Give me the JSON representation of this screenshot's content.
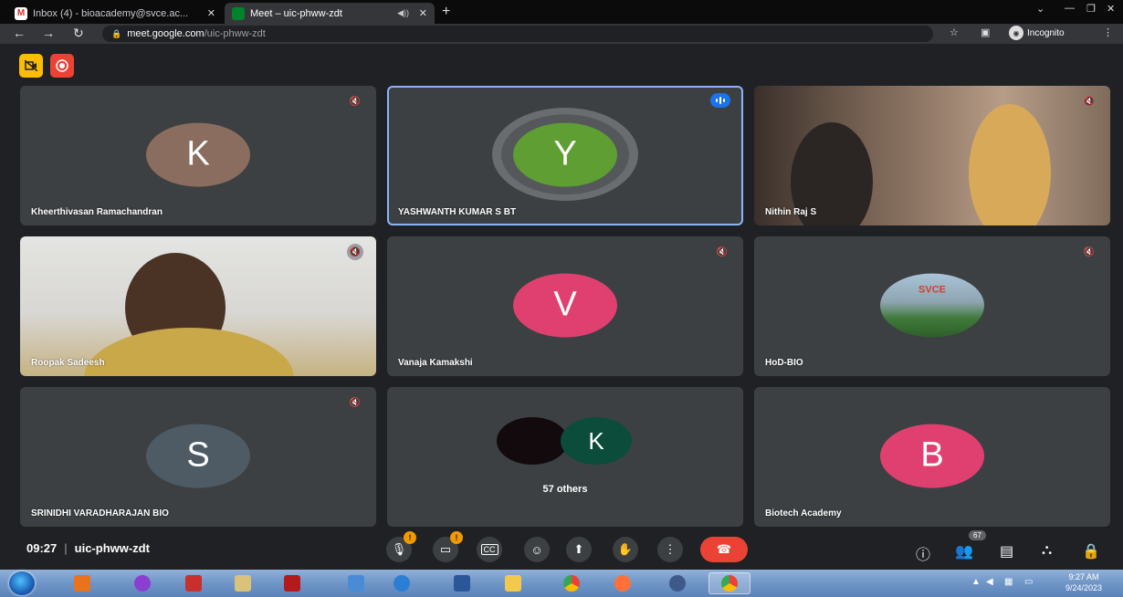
{
  "browser": {
    "tabs": [
      {
        "title": "Inbox (4) - bioacademy@svce.ac..."
      },
      {
        "title": "Meet – uic-phww-zdt"
      }
    ],
    "url_host": "meet.google.com",
    "url_path": "/uic-phww-zdt",
    "incognito_label": "Incognito"
  },
  "tiles": [
    {
      "name": "Kheerthivasan Ramachandran",
      "initial": "K",
      "color": "#8a6d5e"
    },
    {
      "name": "YASHWANTH KUMAR S BT",
      "initial": "Y",
      "color": "#5e9e32"
    },
    {
      "name": "Nithin Raj S"
    },
    {
      "name": "Roopak Sadeesh"
    },
    {
      "name": "Vanaja Kamakshi",
      "initial": "V",
      "color": "#e0406f"
    },
    {
      "name": "HoD-BIO",
      "avatar_text": "SVCE"
    },
    {
      "name": "SRINIDHI VARADHARAJAN BIO",
      "initial": "S",
      "color": "#4e5b64"
    },
    {
      "others_initial": "K",
      "others_label": "57 others"
    },
    {
      "name": "Biotech Academy",
      "initial": "B",
      "color": "#e0406f"
    }
  ],
  "controls": {
    "time": "09:27",
    "meeting_code": "uic-phww-zdt",
    "mic_warning": "!",
    "cam_warning": "!",
    "participants_count": "67"
  },
  "taskbar": {
    "time": "9:27 AM",
    "date": "9/24/2023"
  },
  "colors": {
    "meet_bg": "#202124",
    "tile_bg": "#3c4043",
    "end_call": "#ea4335",
    "speaking": "#8ab4f8"
  }
}
